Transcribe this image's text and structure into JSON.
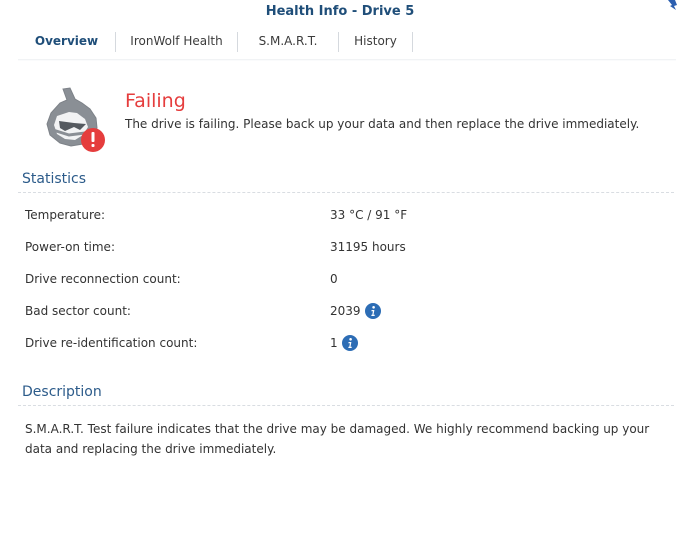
{
  "window": {
    "title": "Health Info - Drive 5"
  },
  "tabs": [
    {
      "label": "Overview",
      "active": true
    },
    {
      "label": "IronWolf Health",
      "active": false
    },
    {
      "label": "S.M.A.R.T.",
      "active": false
    },
    {
      "label": "History",
      "active": false
    }
  ],
  "status": {
    "title": "Failing",
    "message": "The drive is failing. Please back up your data and then replace the drive immediately.",
    "color": "#e53d3d"
  },
  "statistics": {
    "heading": "Statistics",
    "rows": [
      {
        "label": "Temperature:",
        "value": "33 °C / 91 °F"
      },
      {
        "label": "Power-on time:",
        "value": "31195 hours"
      },
      {
        "label": "Drive reconnection count:",
        "value": "0"
      },
      {
        "label": "Bad sector count:",
        "value": "2039"
      },
      {
        "label": "Drive re-identification count:",
        "value": "1"
      }
    ]
  },
  "description": {
    "heading": "Description",
    "text": "S.M.A.R.T. Test failure indicates that the drive may be damaged. We highly recommend backing up your data and replacing the drive immediately."
  },
  "icons": {
    "logo": "ironwolf-drive-logo-icon",
    "alert": "alert-icon",
    "info": "info-icon",
    "corner": "window-corner-icon"
  },
  "colors": {
    "accent": "#1f4e79",
    "heading": "#2c5b8a",
    "danger": "#e53d3d",
    "info": "#2d6db5"
  }
}
